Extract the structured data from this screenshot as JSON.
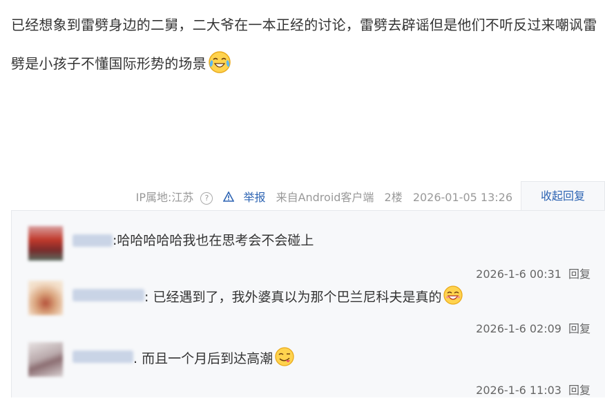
{
  "post": {
    "text": "已经想象到雷劈身边的二舅，二大爷在一本正经的讨论，雷劈去辟谣但是他们不听反过来嘲讽雷劈是小孩子不懂国际形势的场景",
    "emoji": "crying-laughing-emoji"
  },
  "meta": {
    "ip": "IP属地:江苏",
    "report": "举报",
    "source": "来自Android客户端",
    "floor": "2楼",
    "time": "2026-01-05 13:26",
    "collapse": "收起回复"
  },
  "replies": [
    {
      "text": ":哈哈哈哈哈我也在思考会不会碰上",
      "time": "2026-1-6 00:31",
      "reply_label": "回复",
      "emoji": ""
    },
    {
      "text": ": 已经遇到了，我外婆真以为那个巴兰尼科夫是真的",
      "time": "2026-1-6 02:09",
      "reply_label": "回复",
      "emoji": "grinning-emoji"
    },
    {
      "text": ". 而且一个月后到达高潮",
      "time": "2026-1-6 11:03",
      "reply_label": "回复",
      "emoji": "yummy-emoji"
    }
  ],
  "colors": {
    "link": "#2d64b3",
    "panel": "#f7f8fa",
    "meta": "#999999"
  }
}
